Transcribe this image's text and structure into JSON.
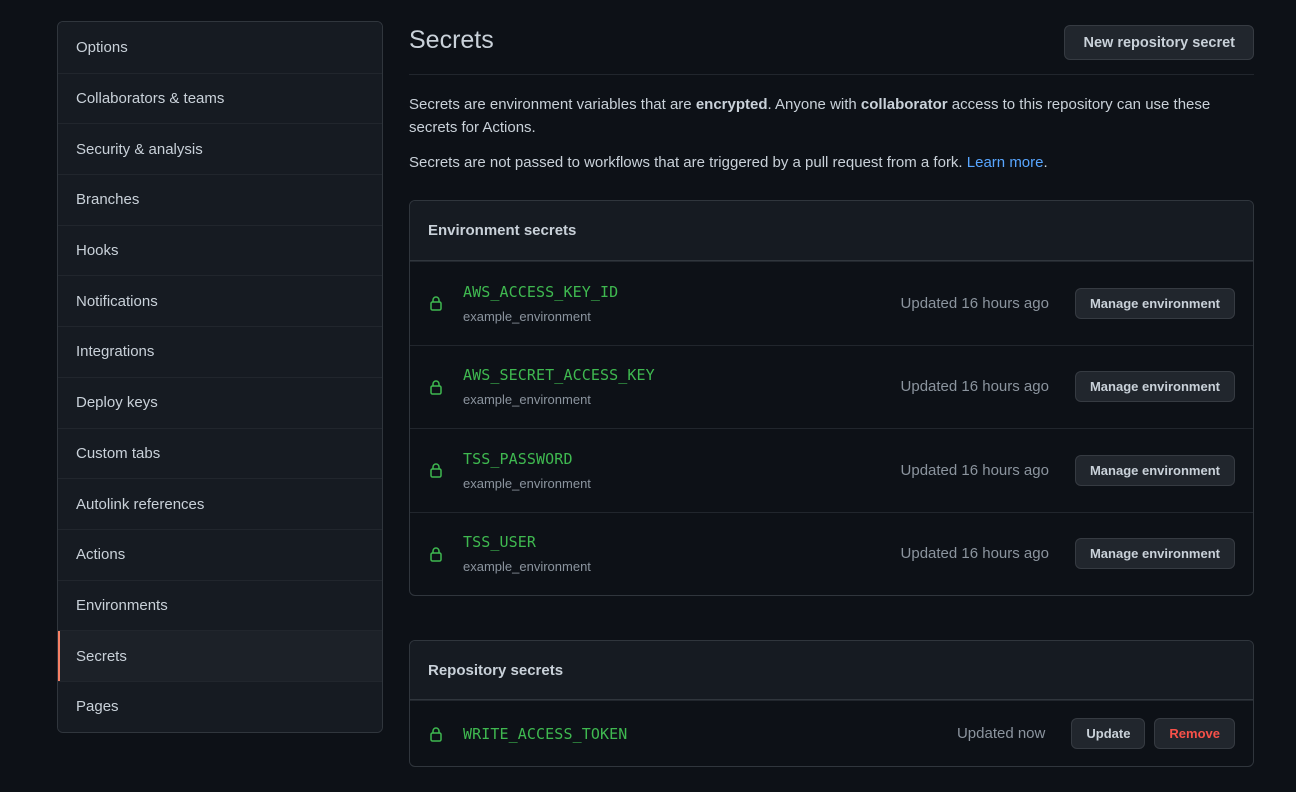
{
  "sidebar": {
    "items": [
      {
        "label": "Options"
      },
      {
        "label": "Collaborators & teams"
      },
      {
        "label": "Security & analysis"
      },
      {
        "label": "Branches"
      },
      {
        "label": "Hooks"
      },
      {
        "label": "Notifications"
      },
      {
        "label": "Integrations"
      },
      {
        "label": "Deploy keys"
      },
      {
        "label": "Custom tabs"
      },
      {
        "label": "Autolink references"
      },
      {
        "label": "Actions"
      },
      {
        "label": "Environments"
      },
      {
        "label": "Secrets",
        "active": true
      },
      {
        "label": "Pages"
      }
    ]
  },
  "header": {
    "title": "Secrets",
    "new_secret_label": "New repository secret"
  },
  "description": {
    "line1_part1": "Secrets are environment variables that are ",
    "line1_bold1": "encrypted",
    "line1_part2": ". Anyone with ",
    "line1_bold2": "collaborator",
    "line1_part3": " access to this repository can use these secrets for Actions.",
    "line2_text": "Secrets are not passed to workflows that are triggered by a pull request from a fork. ",
    "learn_more": "Learn more",
    "line2_end": "."
  },
  "environment_secrets": {
    "title": "Environment secrets",
    "manage_label": "Manage environment",
    "rows": [
      {
        "name": "AWS_ACCESS_KEY_ID",
        "environment": "example_environment",
        "updated": "Updated 16 hours ago"
      },
      {
        "name": "AWS_SECRET_ACCESS_KEY",
        "environment": "example_environment",
        "updated": "Updated 16 hours ago"
      },
      {
        "name": "TSS_PASSWORD",
        "environment": "example_environment",
        "updated": "Updated 16 hours ago"
      },
      {
        "name": "TSS_USER",
        "environment": "example_environment",
        "updated": "Updated 16 hours ago"
      }
    ]
  },
  "repository_secrets": {
    "title": "Repository secrets",
    "rows": [
      {
        "name": "WRITE_ACCESS_TOKEN",
        "updated": "Updated now",
        "update_label": "Update",
        "remove_label": "Remove"
      }
    ]
  },
  "colors": {
    "background": "#0d1117",
    "accent_active": "#f78166",
    "secret_name": "#3fb950",
    "link": "#58a6ff",
    "danger": "#f85149"
  },
  "icons": {
    "secret": "lock-icon"
  }
}
